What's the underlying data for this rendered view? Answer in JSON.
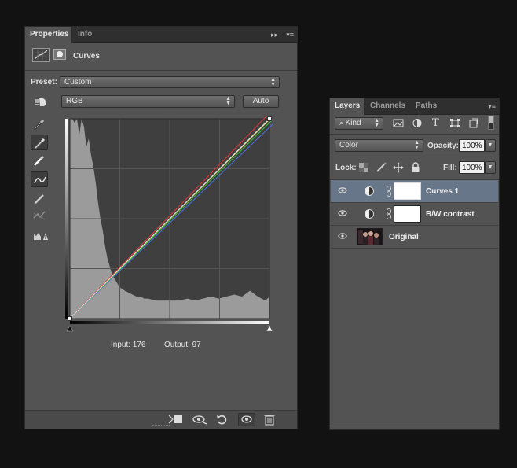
{
  "properties_panel": {
    "tabs": [
      {
        "label": "Properties"
      },
      {
        "label": "Info"
      }
    ],
    "panel_controls": {
      "collapse": "▸▸",
      "menu": "▾≡"
    },
    "header_title": "Curves",
    "preset_label": "Preset:",
    "preset_value": "Custom",
    "channel_value": "RGB",
    "auto_label": "Auto",
    "readout": {
      "input_label": "Input: 176",
      "output_label": "Output: 97"
    },
    "tools": [
      {
        "icon": "on-image-adjust-icon",
        "selected": false
      },
      {
        "icon": "black-point-eyedropper-icon",
        "selected": false
      },
      {
        "icon": "gray-point-eyedropper-icon",
        "selected": true
      },
      {
        "icon": "white-point-eyedropper-icon",
        "selected": false
      },
      {
        "icon": "curve-points-icon",
        "selected": true
      },
      {
        "icon": "pencil-icon",
        "selected": false
      },
      {
        "icon": "smooth-curve-icon",
        "selected": false
      },
      {
        "icon": "clipping-warning-icon",
        "selected": false
      }
    ],
    "footer_icons": [
      "clip-to-layer-icon",
      "toggle-previous-state-icon",
      "reset-icon",
      "visibility-eye-icon",
      "trash-icon"
    ],
    "chart_data": {
      "type": "area",
      "x": [
        0,
        3,
        6,
        9,
        12,
        15,
        18,
        21,
        24,
        27,
        30,
        33,
        36,
        39,
        42,
        45,
        48,
        51,
        54,
        57,
        60,
        63,
        66,
        70,
        75,
        80,
        85,
        90,
        95,
        100,
        110,
        120,
        130,
        140,
        150,
        160,
        170,
        180,
        190,
        200,
        210,
        220,
        230,
        240,
        245,
        250,
        255
      ],
      "values": [
        100,
        100,
        98,
        100,
        92,
        100,
        96,
        86,
        90,
        82,
        76,
        68,
        58,
        50,
        44,
        36,
        30,
        26,
        22,
        20,
        18,
        16,
        15,
        14,
        13,
        12,
        11,
        11,
        10,
        10,
        9,
        9,
        9,
        9,
        10,
        9,
        10,
        11,
        10,
        11,
        12,
        11,
        14,
        11,
        10,
        9,
        11
      ],
      "xlim": [
        0,
        255
      ],
      "ylim": [
        0,
        100
      ],
      "grid": true,
      "curve_points": [
        [
          0,
          0
        ],
        [
          255,
          255
        ]
      ],
      "colors": {
        "histogram": "#9b9b9b",
        "plot_bg": "#3f3f3f",
        "grid": "#555555",
        "rgb": "#d9d9d9",
        "red": "#e03838",
        "green": "#3ec23e",
        "blue": "#4a6fe0",
        "yellow": "#e8e060"
      }
    }
  },
  "layers_panel": {
    "tabs": [
      {
        "label": "Layers"
      },
      {
        "label": "Channels"
      },
      {
        "label": "Paths"
      }
    ],
    "panel_menu": "▾≡",
    "filter_kind": "Kind",
    "blend_mode": "Color",
    "opacity_label": "Opacity:",
    "opacity_value": "100%",
    "lock_label": "Lock:",
    "fill_label": "Fill:",
    "fill_value": "100%",
    "layers": [
      {
        "name": "Curves 1",
        "selected": true
      },
      {
        "name": "B/W contrast",
        "selected": false
      },
      {
        "name": "Original",
        "selected": false
      }
    ]
  },
  "colors": {
    "panel_bg": "#535353",
    "tab_bar": "#2f2f2f",
    "selected_layer": "#677689",
    "app_bg": "#121212"
  }
}
